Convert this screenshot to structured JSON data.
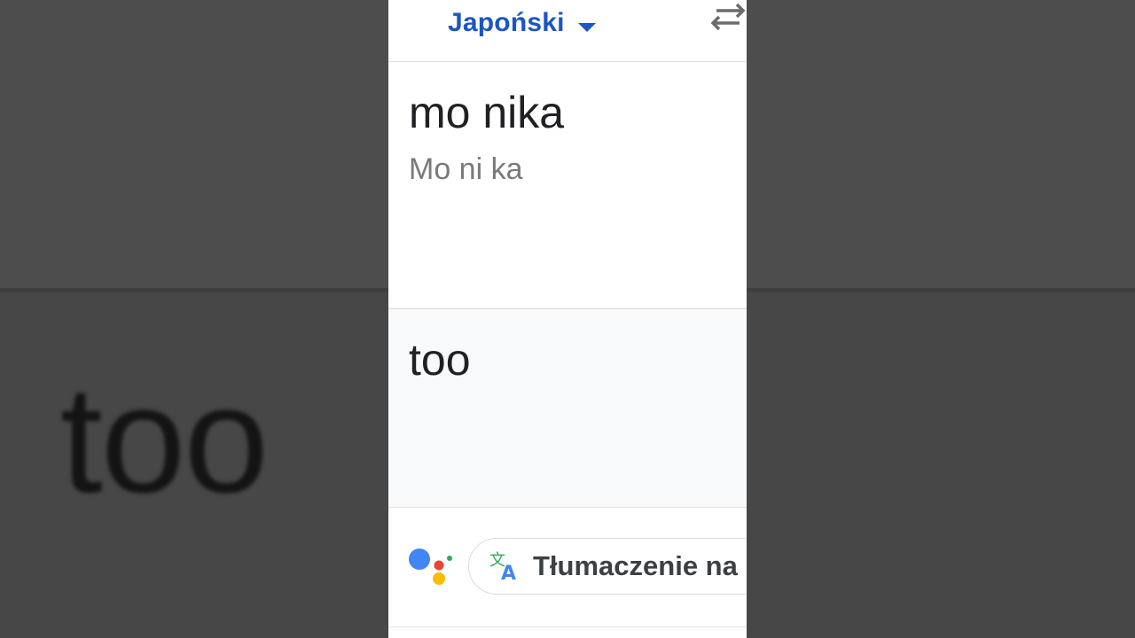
{
  "background": {
    "blurred_word": "too"
  },
  "header": {
    "language_label": "Japoński",
    "dropdown_icon": "caret-down-icon",
    "swap_icon": "swap-languages-icon"
  },
  "source": {
    "text": "mo nika",
    "transliteration": "Mo ni ka"
  },
  "result": {
    "text": "too"
  },
  "assistant": {
    "logo_icon": "google-assistant-icon",
    "chip_icon": "translate-icon",
    "chip_label": "Tłumaczenie na"
  },
  "colors": {
    "accent": "#1a56c4",
    "assistant_blue": "#4285f4",
    "assistant_red": "#ea4335",
    "assistant_yellow": "#fbbc04",
    "assistant_green": "#34a853"
  }
}
